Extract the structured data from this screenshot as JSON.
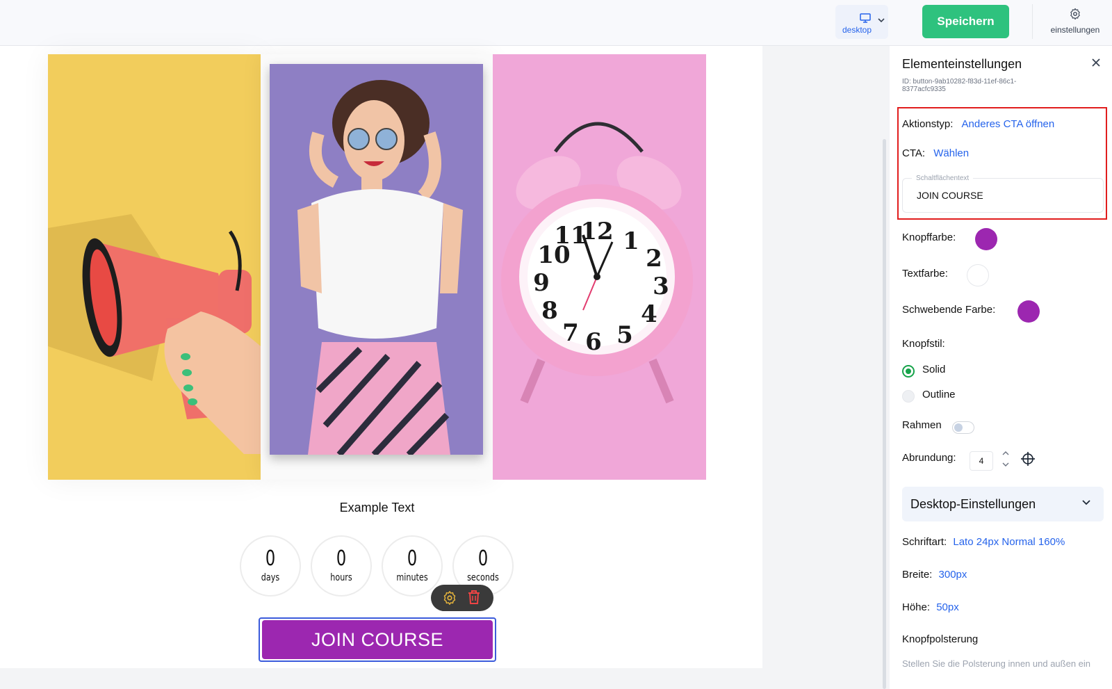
{
  "topbar": {
    "device_label": "desktop",
    "save_label": "Speichern",
    "settings_label": "einstellungen"
  },
  "canvas": {
    "example_text": "Example Text",
    "countdown": [
      {
        "value": "0",
        "unit": "days"
      },
      {
        "value": "0",
        "unit": "hours"
      },
      {
        "value": "0",
        "unit": "minutes"
      },
      {
        "value": "0",
        "unit": "seconds"
      }
    ],
    "cta_label": "JOIN COURSE",
    "cta_color": "#9c27b0"
  },
  "panel": {
    "title": "Elementeinstellungen",
    "element_id": "ID: button-9ab10282-f83d-11ef-86c1-8377acfc9335",
    "action_type_label": "Aktionstyp:",
    "action_type_value": "Anderes CTA öffnen",
    "cta_label": "CTA:",
    "cta_value": "Wählen",
    "button_text_label": "Schaltflächentext",
    "button_text_value": "JOIN COURSE",
    "button_color_label": "Knopffarbe:",
    "button_color": "#9c27b0",
    "text_color_label": "Textfarbe:",
    "text_color": "#ffffff",
    "hover_color_label": "Schwebende Farbe:",
    "hover_color": "#9c27b0",
    "button_style_label": "Knopfstil:",
    "style_options": [
      "Solid",
      "Outline"
    ],
    "selected_style": "Solid",
    "border_label": "Rahmen",
    "rounding_label": "Abrundung:",
    "rounding_value": "4",
    "desktop_settings_title": "Desktop-Einstellungen",
    "font_label": "Schriftart:",
    "font_value": "Lato 24px Normal 160%",
    "width_label": "Breite:",
    "width_value": "300px",
    "height_label": "Höhe:",
    "height_value": "50px",
    "padding_label": "Knopfpolsterung",
    "padding_hint": "Stellen Sie die Polsterung innen und außen ein"
  }
}
